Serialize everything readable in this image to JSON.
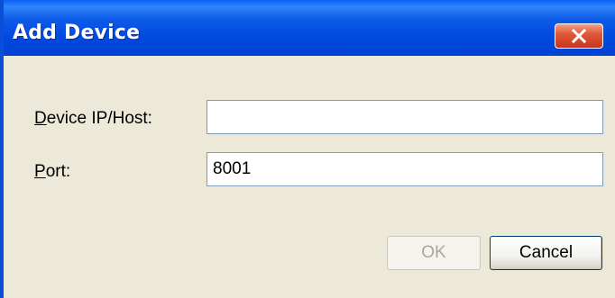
{
  "window": {
    "title": "Add Device",
    "close_icon": "close-icon"
  },
  "form": {
    "host_label_mnemonic": "D",
    "host_label_rest": "evice IP/Host:",
    "host_value": "",
    "port_label_mnemonic": "P",
    "port_label_rest": "ort:",
    "port_value": "8001"
  },
  "buttons": {
    "ok_label": "OK",
    "ok_enabled": false,
    "cancel_label": "Cancel"
  },
  "colors": {
    "titlebar": "#0048df",
    "dialog_bg": "#ece9d8",
    "close_button": "#c6361c"
  }
}
